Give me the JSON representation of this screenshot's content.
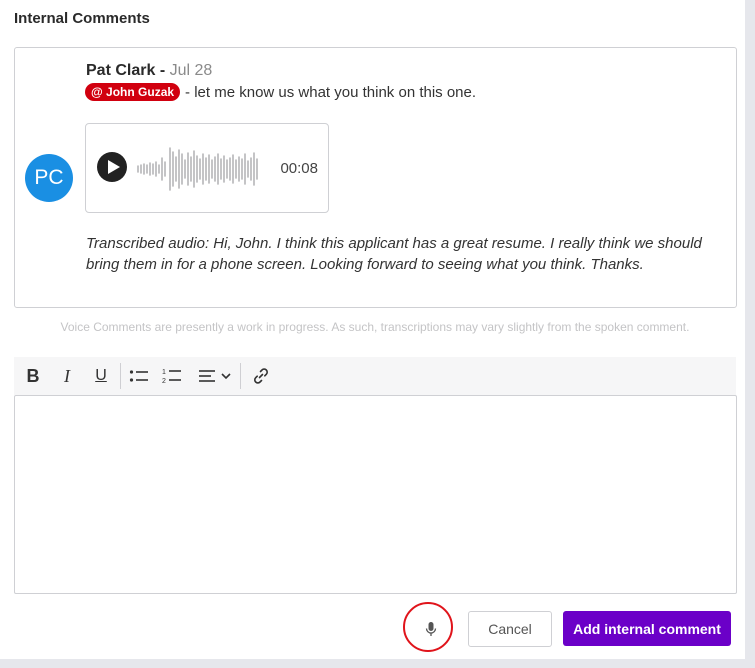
{
  "section": {
    "title": "Internal Comments"
  },
  "comment": {
    "avatar_initials": "PC",
    "author": "Pat Clark -",
    "date": "Jul 28",
    "mention": "@ John Guzak",
    "text": "- let me know us what you think on this one.",
    "audio": {
      "duration": "00:08",
      "play_icon": "play-icon"
    },
    "transcript": "Transcribed audio: Hi, John. I think this applicant has a great resume. I really think we should bring them in for a phone screen. Looking forward to seeing what you think. Thanks."
  },
  "disclaimer": "Voice Comments are presently a work in progress. As such, transcriptions may vary slightly from the spoken comment.",
  "toolbar": {
    "bold_label": "B",
    "italic_label": "I",
    "underline_label": "U"
  },
  "editor": {
    "value": ""
  },
  "actions": {
    "cancel_label": "Cancel",
    "submit_label": "Add internal comment"
  },
  "colors": {
    "accent": "#6b00c8",
    "mention_bg": "#d1000f",
    "avatar_bg": "#1a8fe3",
    "highlight_ring": "#e0141b"
  }
}
